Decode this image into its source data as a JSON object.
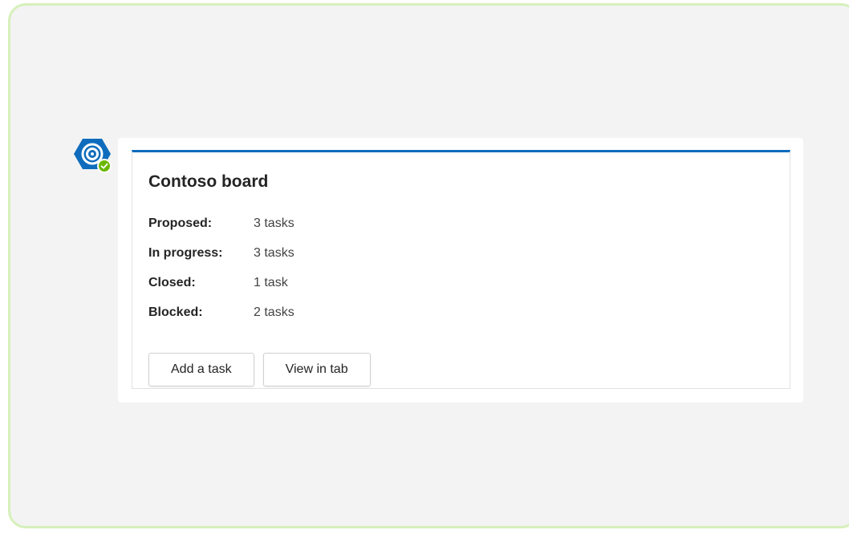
{
  "card": {
    "title": "Contoso board",
    "facts": [
      {
        "label": "Proposed:",
        "value": "3 tasks"
      },
      {
        "label": "In progress:",
        "value": "3 tasks"
      },
      {
        "label": "Closed:",
        "value": "1 task"
      },
      {
        "label": "Blocked:",
        "value": "2 tasks"
      }
    ],
    "actions": [
      {
        "label": "Add a task"
      },
      {
        "label": "View in tab"
      }
    ]
  },
  "avatar": {
    "icon": "bot-hexagon-icon",
    "status_icon": "check-badge-icon",
    "colors": {
      "hexagon": "#0f6cbd",
      "status": "#6bb700"
    }
  },
  "colors": {
    "accent": "#0f6cbd",
    "frame_border": "#d6f0ba",
    "background": "#f3f3f3"
  }
}
